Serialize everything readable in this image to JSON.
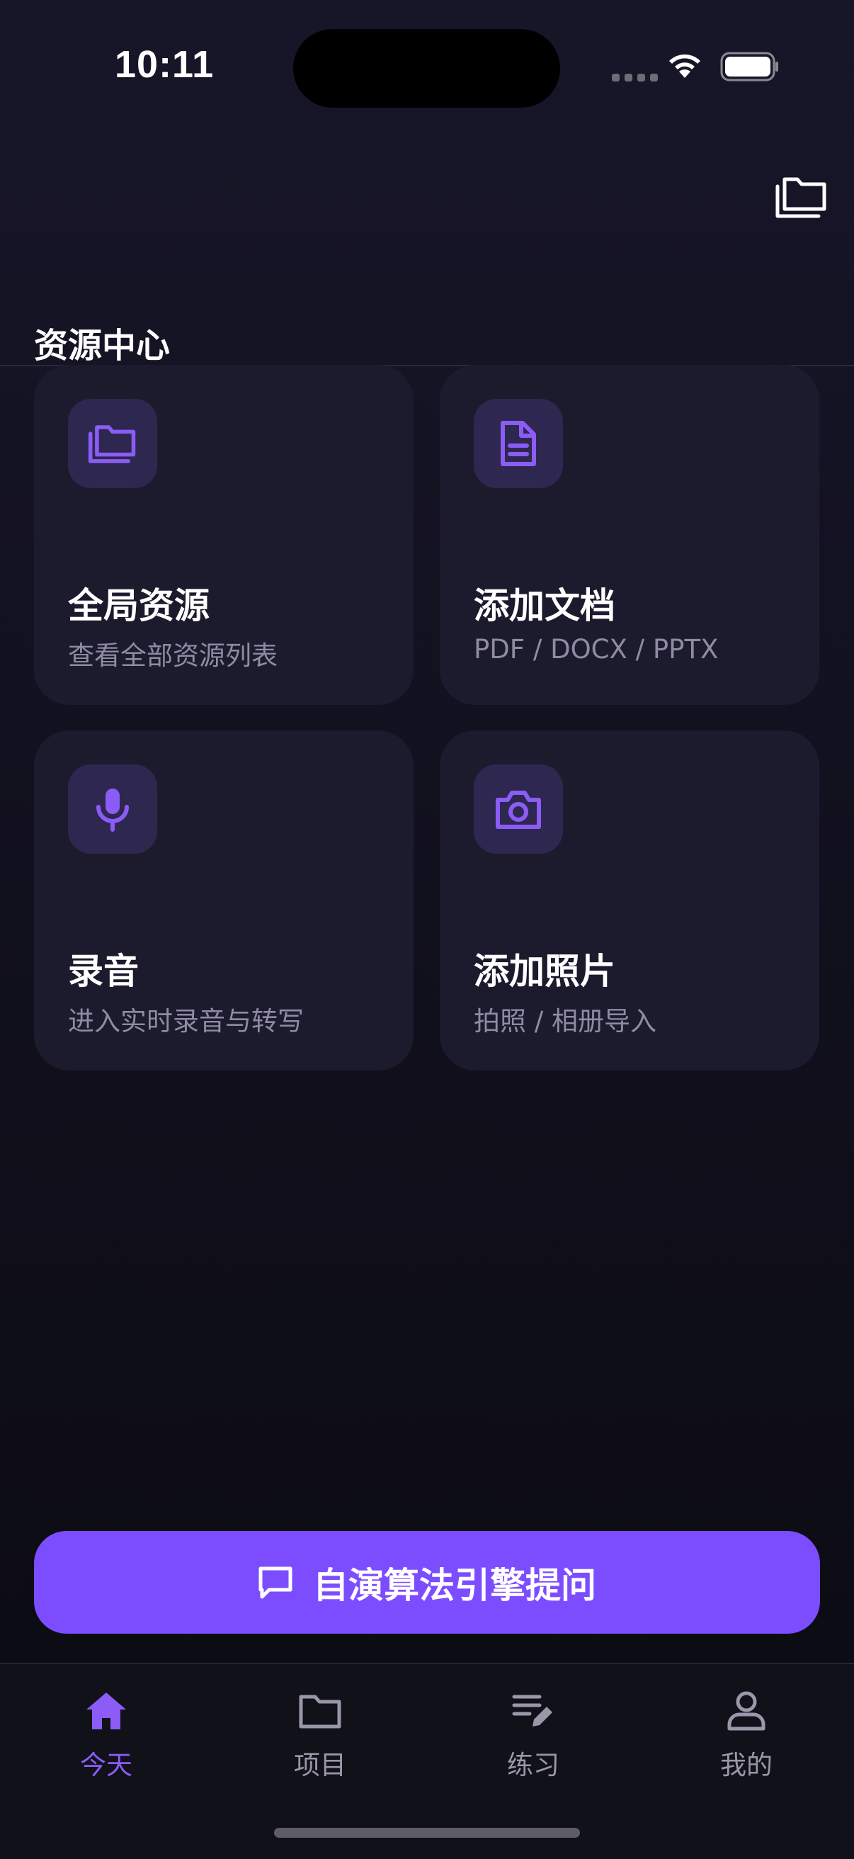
{
  "status": {
    "time": "10:11"
  },
  "section": {
    "title": "资源中心"
  },
  "cards": [
    {
      "title": "全局资源",
      "subtitle": "查看全部资源列表",
      "icon": "folders-icon"
    },
    {
      "title": "添加文档",
      "subtitle": "PDF / DOCX / PPTX",
      "icon": "document-icon"
    },
    {
      "title": "录音",
      "subtitle": "进入实时录音与转写",
      "icon": "microphone-icon"
    },
    {
      "title": "添加照片",
      "subtitle": "拍照 / 相册导入",
      "icon": "camera-icon"
    }
  ],
  "ask": {
    "label": "自演算法引擎提问",
    "icon": "chat-bubble-icon"
  },
  "tabs": [
    {
      "label": "今天",
      "icon": "home-icon",
      "active": true
    },
    {
      "label": "项目",
      "icon": "folder-icon",
      "active": false
    },
    {
      "label": "练习",
      "icon": "edit-list-icon",
      "active": false
    },
    {
      "label": "我的",
      "icon": "person-icon",
      "active": false
    }
  ],
  "colors": {
    "accent": "#7c4dff",
    "card": "#1c1b2e",
    "icon_bg": "#2e2750",
    "icon": "#8b5cf6"
  }
}
